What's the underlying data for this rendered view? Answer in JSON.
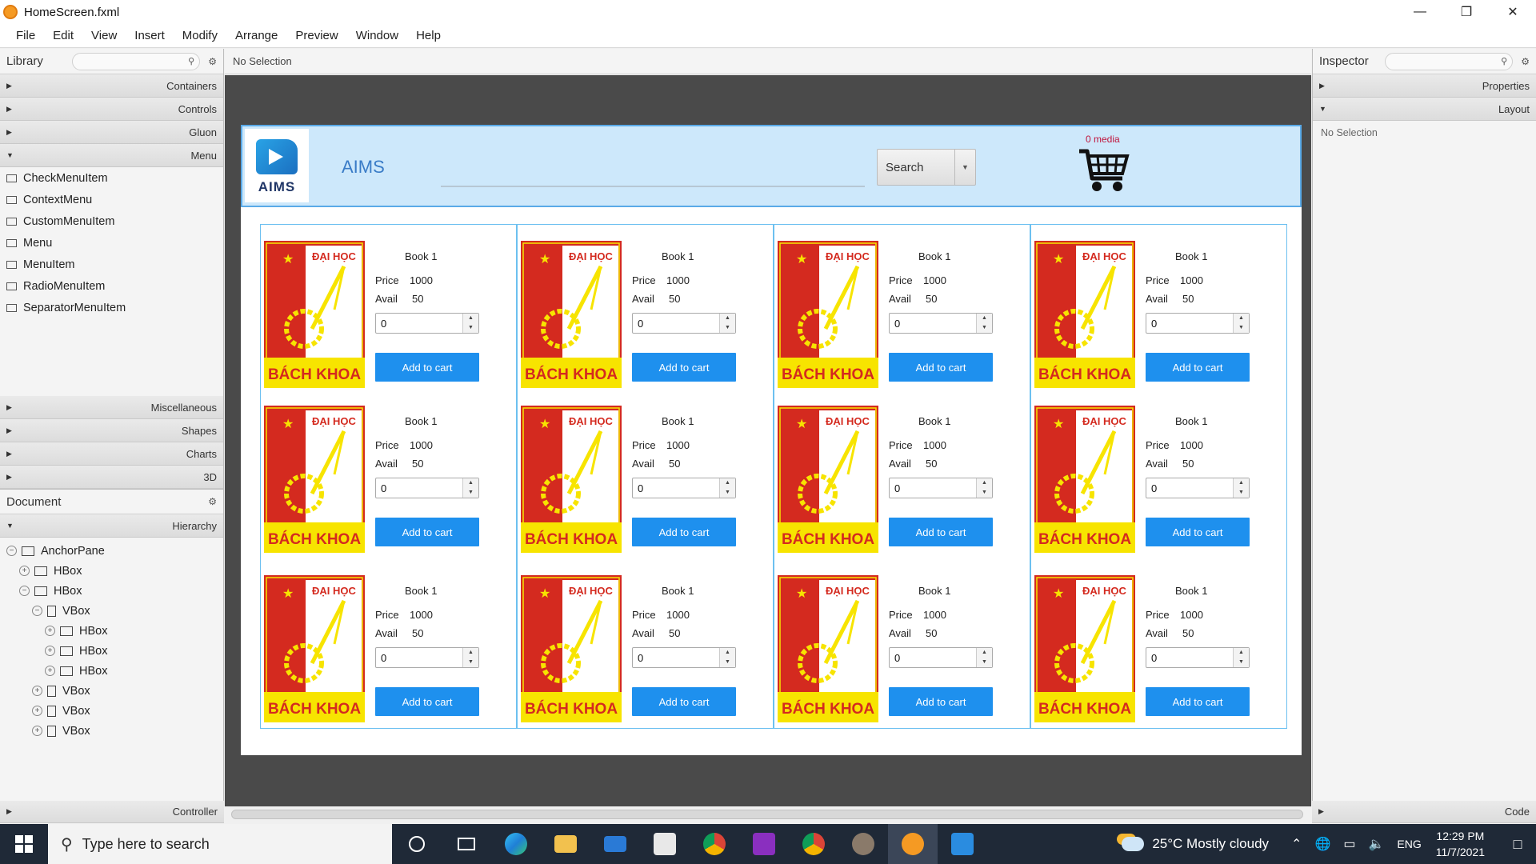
{
  "window": {
    "title": "HomeScreen.fxml"
  },
  "menu": [
    "File",
    "Edit",
    "View",
    "Insert",
    "Modify",
    "Arrange",
    "Preview",
    "Window",
    "Help"
  ],
  "library": {
    "title": "Library",
    "sections_top": [
      "Containers",
      "Controls",
      "Gluon",
      "Menu"
    ],
    "menu_items": [
      "CheckMenuItem",
      "ContextMenu",
      "CustomMenuItem",
      "Menu",
      "MenuItem",
      "RadioMenuItem",
      "SeparatorMenuItem"
    ],
    "sections_bottom": [
      "Miscellaneous",
      "Shapes",
      "Charts",
      "3D"
    ]
  },
  "document": {
    "title": "Document",
    "hierarchy_label": "Hierarchy",
    "tree": [
      {
        "label": "AnchorPane",
        "toggle": "−",
        "indent": 0,
        "icon": "anchorpane-icon"
      },
      {
        "label": "HBox",
        "toggle": "+",
        "indent": 1,
        "icon": "hbox-icon"
      },
      {
        "label": "HBox",
        "toggle": "−",
        "indent": 1,
        "icon": "hbox-icon"
      },
      {
        "label": "VBox",
        "toggle": "−",
        "indent": 2,
        "icon": "vbox-icon"
      },
      {
        "label": "HBox",
        "toggle": "+",
        "indent": 3,
        "icon": "hbox-icon"
      },
      {
        "label": "HBox",
        "toggle": "+",
        "indent": 3,
        "icon": "hbox-icon"
      },
      {
        "label": "HBox",
        "toggle": "+",
        "indent": 3,
        "icon": "hbox-icon"
      },
      {
        "label": "VBox",
        "toggle": "+",
        "indent": 2,
        "icon": "vbox-icon"
      },
      {
        "label": "VBox",
        "toggle": "+",
        "indent": 2,
        "icon": "vbox-icon"
      },
      {
        "label": "VBox",
        "toggle": "+",
        "indent": 2,
        "icon": "vbox-icon"
      }
    ],
    "controller_label": "Controller"
  },
  "center": {
    "selection": "No Selection"
  },
  "app": {
    "logo_text": "AIMS",
    "title": "AIMS",
    "search_label": "Search",
    "cart_count": "0 media",
    "card_template": {
      "name": "Book 1",
      "price_label": "Price",
      "price": "1000",
      "avail_label": "Avail",
      "avail": "50",
      "qty": "0",
      "button": "Add to cart",
      "cover_top": "ĐẠI HỌC",
      "cover_bottom": "BÁCH KHOA"
    },
    "columns": 4,
    "rows": 3
  },
  "inspector": {
    "title": "Inspector",
    "sections": [
      "Properties",
      "Layout"
    ],
    "selection": "No Selection",
    "code_label": "Code"
  },
  "taskbar": {
    "search_placeholder": "Type here to search",
    "weather": "25°C  Mostly cloudy",
    "lang": "ENG",
    "time": "12:29 PM",
    "date": "11/7/2021"
  },
  "colors": {
    "accent_blue": "#1e90ee",
    "header_bg": "#cde8fb",
    "cover_red": "#d42a1f",
    "cover_yellow": "#f7e400",
    "cart_count": "#c0143c"
  }
}
